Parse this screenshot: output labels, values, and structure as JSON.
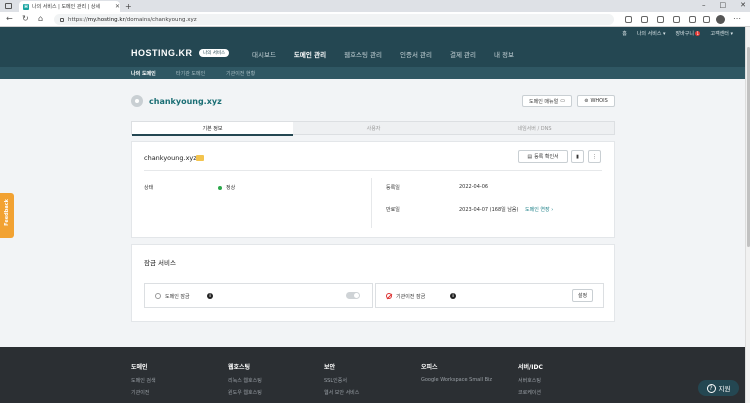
{
  "browser": {
    "tab_title": "나의 서비스 | 도메인 관리 | 상세",
    "url_prefix": "https://",
    "url_host": "my.hosting.kr",
    "url_path": "/domains/chankyoung.xyz"
  },
  "header": {
    "util": {
      "home": "홈",
      "my_services": "나의 서비스",
      "cart": "장바구니",
      "cart_count": "1",
      "support": "고객센터"
    },
    "logo": "HOSTING.KR",
    "logo_tag": "나의 서비스",
    "nav": [
      "대시보드",
      "도메인 관리",
      "웹호스팅 관리",
      "인증서 관리",
      "결제 관리",
      "내 정보"
    ],
    "active_nav": "도메인 관리",
    "subnav": [
      "나의 도메인",
      "타기관 도메인",
      "기관이전 현황"
    ],
    "active_subnav": "나의 도메인"
  },
  "domain": {
    "name": "chankyoung.xyz",
    "manual_button": "도메인 매뉴얼",
    "whois_button": "WHOIS",
    "tabs": [
      "기본 정보",
      "사용자",
      "네임서버 / DNS"
    ],
    "active_tab": "기본 정보",
    "card_name": "chankyoung.xyz",
    "cert_button": "등록 확인서",
    "status_label": "상태",
    "status_value": "정상",
    "reg_label": "등록일",
    "reg_value": "2022-04-06",
    "exp_label": "만료일",
    "exp_value": "2023-04-07 (168일 남음)",
    "extend_link": "도메인 연장"
  },
  "lock_service": {
    "title": "잠금 서비스",
    "domain_lock": "도메인 잠금",
    "transfer_lock": "기관이전 잠금",
    "settings_button": "설정"
  },
  "feedback": "Feedback",
  "footer": {
    "columns": [
      {
        "title": "도메인",
        "items": [
          "도메인 검색",
          "기관이전"
        ]
      },
      {
        "title": "웹호스팅",
        "items": [
          "리눅스 웹호스팅",
          "윈도우 웹호스팅"
        ]
      },
      {
        "title": "보안",
        "items": [
          "SSL인증서",
          "웹서 보안 서비스"
        ]
      },
      {
        "title": "오피스",
        "items": [
          "Google Workspace Small Biz"
        ]
      },
      {
        "title": "서버/IDC",
        "items": [
          "서버호스팅",
          "코로케이션"
        ]
      }
    ]
  },
  "help_button": "지원"
}
